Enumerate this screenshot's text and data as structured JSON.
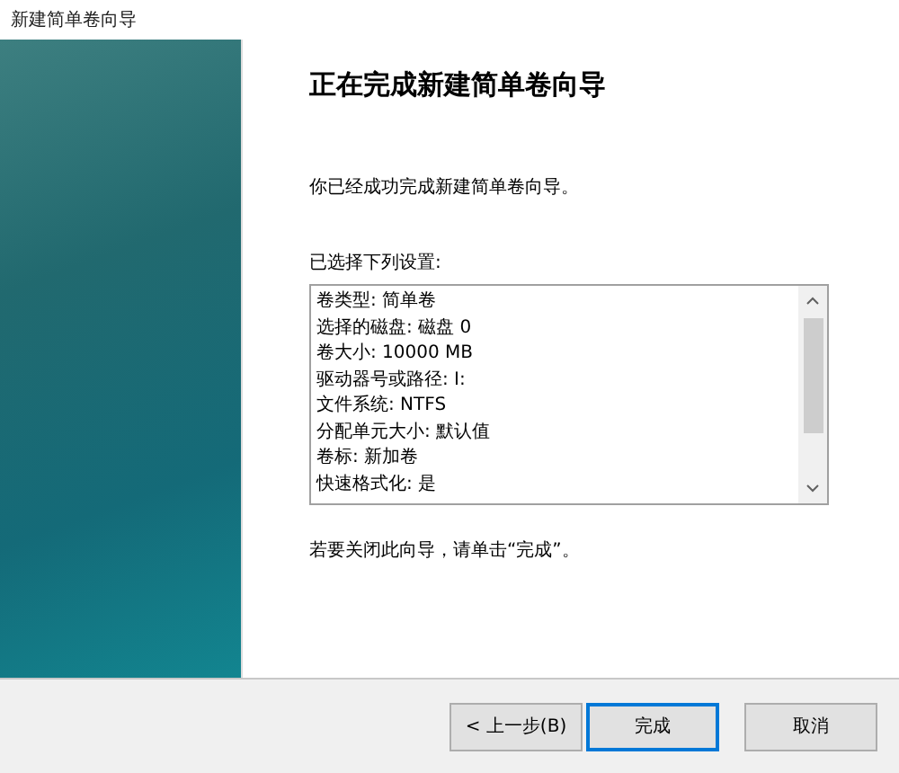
{
  "window": {
    "title": "新建简单卷向导"
  },
  "heading": "正在完成新建简单卷向导",
  "intro": "你已经成功完成新建简单卷向导。",
  "settings_label": "已选择下列设置:",
  "settings": [
    "卷类型: 简单卷",
    "选择的磁盘: 磁盘 0",
    "卷大小: 10000 MB",
    "驱动器号或路径: I:",
    "文件系统: NTFS",
    "分配单元大小: 默认值",
    "卷标: 新加卷",
    "快速格式化: 是"
  ],
  "footer_note": "若要关闭此向导，请单击“完成”。",
  "buttons": [
    {
      "label": "< 上一步(B)",
      "default": false
    },
    {
      "label": "完成",
      "default": true
    },
    {
      "label": "取消",
      "default": false
    }
  ]
}
